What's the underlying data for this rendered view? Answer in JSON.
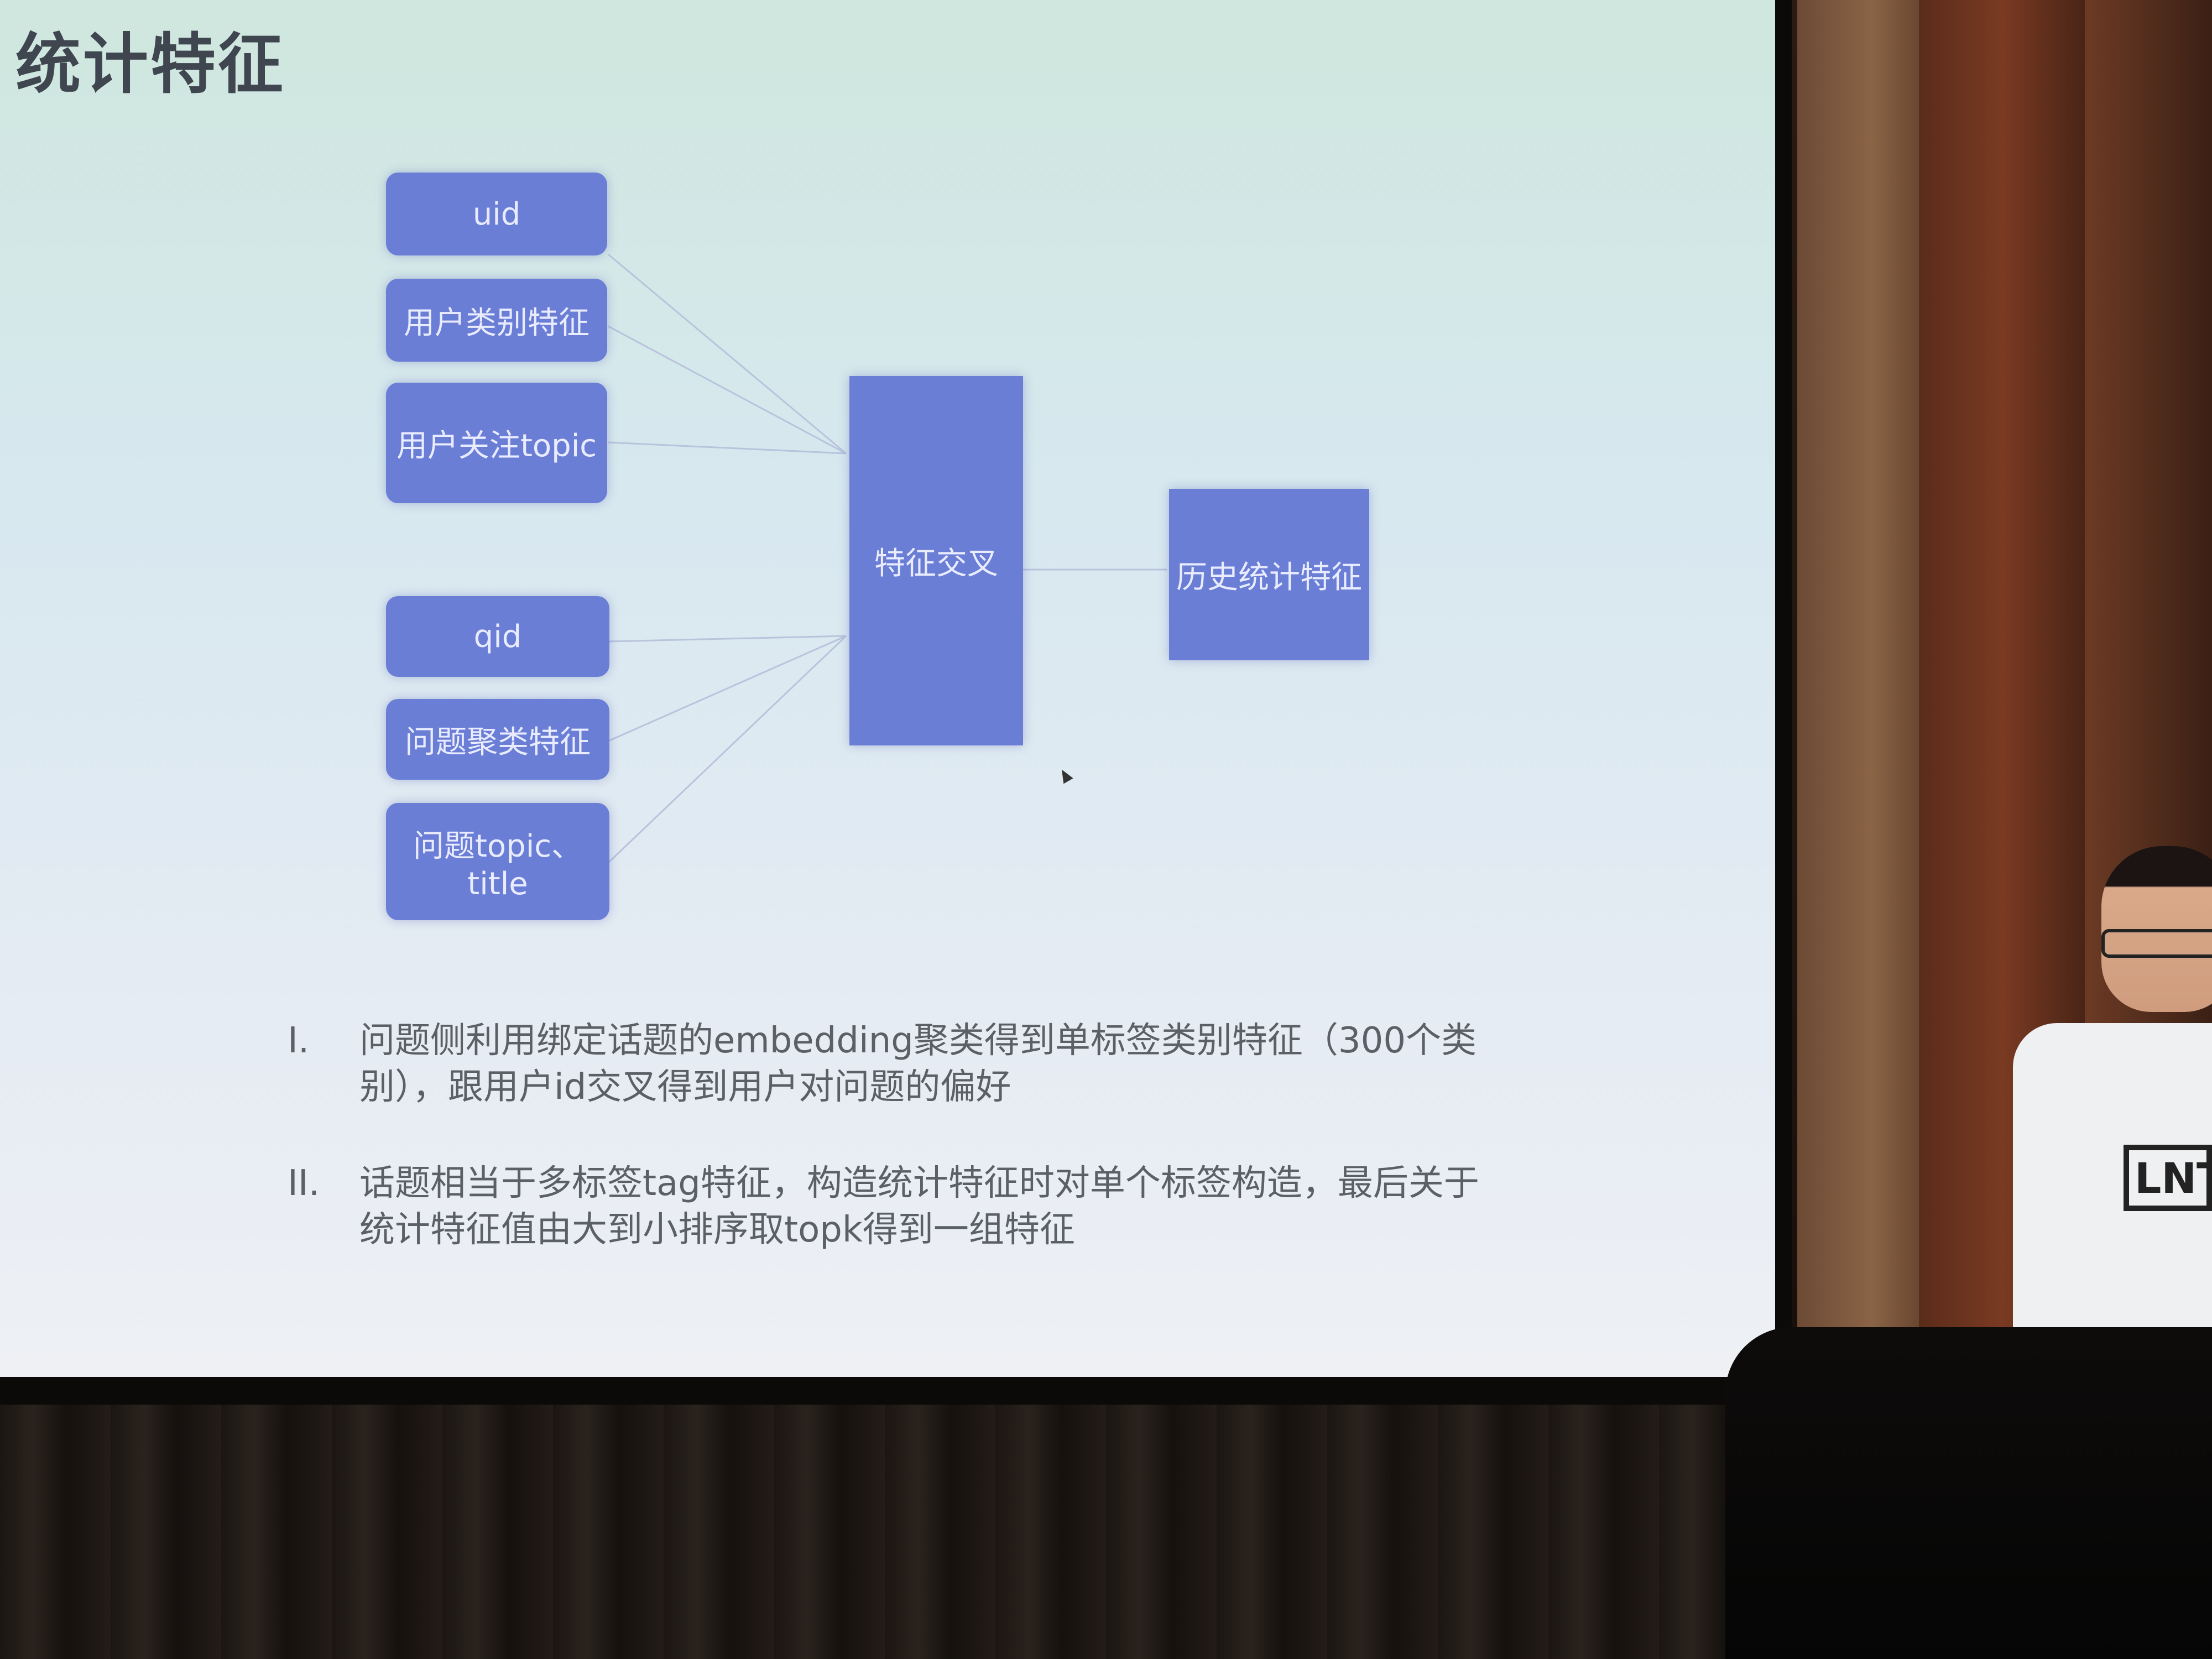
{
  "slide": {
    "title": "统计特征",
    "left_boxes_top": [
      "uid",
      "用户类别特征",
      "用户关注topic"
    ],
    "left_boxes_bottom": [
      "qid",
      "问题聚类特征",
      "问题topic、title"
    ],
    "center_box": "特征交叉",
    "right_box": "历史统计特征",
    "list": [
      {
        "marker": "I.",
        "text": "问题侧利用绑定话题的embedding聚类得到单标签类别特征（300个类别），跟用户id交叉得到用户对问题的偏好"
      },
      {
        "marker": "II.",
        "text": "话题相当于多标签tag特征，构造统计特征时对单个标签构造，最后关于统计特征值由大到小排序取topk得到一组特征"
      }
    ]
  },
  "presenter": {
    "shirt_text": "LNT"
  },
  "colors": {
    "box_fill": "#6b7ed6",
    "slide_top": "#cfe7de",
    "slide_bottom": "#eef0f4",
    "text_gray": "#5b6066"
  }
}
